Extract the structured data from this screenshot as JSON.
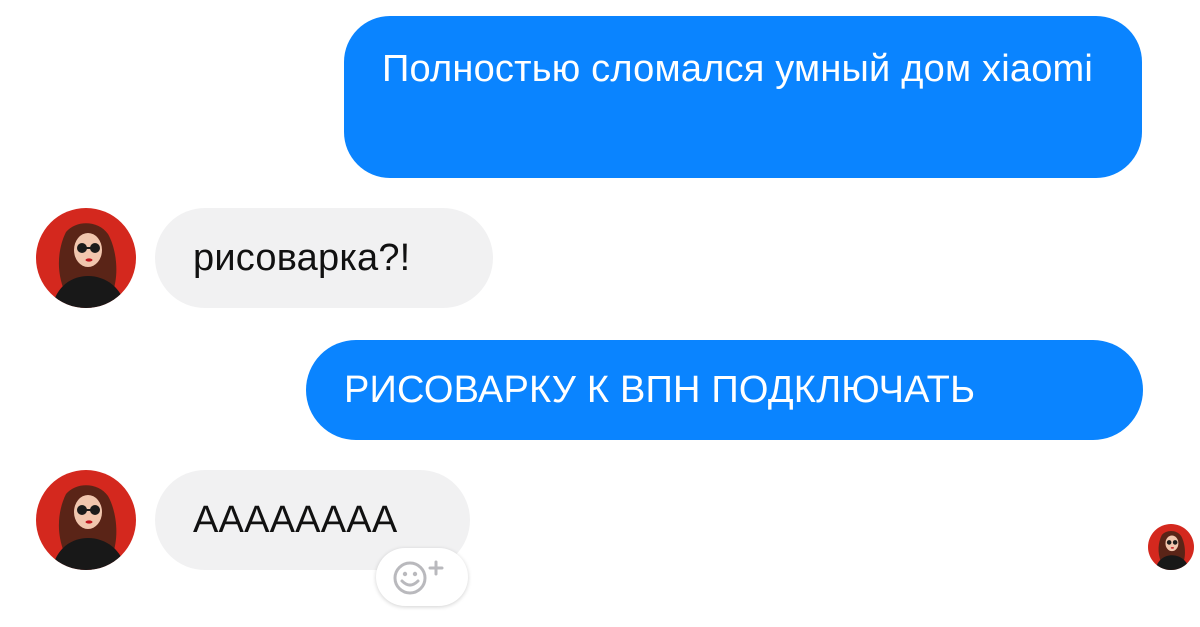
{
  "messages": [
    {
      "direction": "outgoing",
      "text": "Полностью сломался умный дом xiaomi"
    },
    {
      "direction": "incoming",
      "text": "рисоварка?!"
    },
    {
      "direction": "outgoing",
      "text": "РИСОВАРКУ К ВПН ПОДКЛЮЧАТЬ"
    },
    {
      "direction": "incoming",
      "text": "АААААААА"
    }
  ],
  "icons": {
    "avatar": "contact-avatar-photo",
    "seen": "seen-avatar-indicator",
    "reaction": "add-reaction-smiley-plus-icon"
  },
  "colors": {
    "outgoing_bubble": "#0a84ff",
    "incoming_bubble": "#f1f1f2",
    "background": "#ffffff",
    "avatar_background": "#d4281e"
  }
}
